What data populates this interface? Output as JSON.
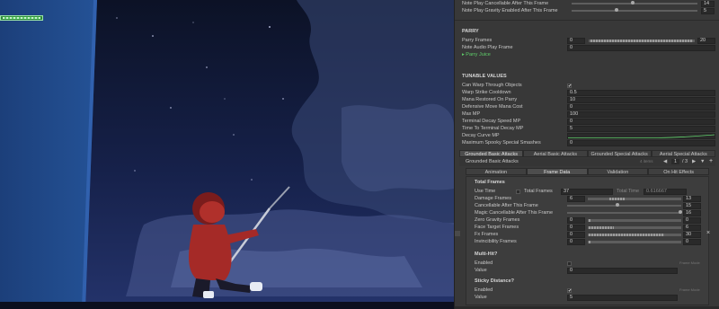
{
  "colors": {
    "accent_green": "#5fcf6a",
    "scene_sky": "#1b2a55",
    "character_red": "#b0302b"
  },
  "top": {
    "rows": [
      {
        "label": "Note Play Cancellable After This Frame",
        "value": "14",
        "slider_fraction": 0.93
      },
      {
        "label": "Note Play Gravity Enabled After This Frame",
        "value": "5",
        "slider_fraction": 0.33
      }
    ]
  },
  "parry": {
    "title": "PARRY",
    "frames_label": "Parry Frames",
    "frames_min": "0",
    "frames_max": "20",
    "audio_label": "Note Audio Play Frame",
    "audio_value": "0",
    "juice_label": "Parry Juice"
  },
  "tunable": {
    "title": "TUNABLE VALUES",
    "rows": [
      {
        "label": "Can Warp Through Objects",
        "value": "✔"
      },
      {
        "label": "Warp Strike Cooldown",
        "value": "0.5"
      },
      {
        "label": "Mana Restored On Parry",
        "value": "10"
      },
      {
        "label": "Defensive Move Mana Cost",
        "value": "0"
      },
      {
        "label": "Max MP",
        "value": "100"
      },
      {
        "label": "Terminal Decay Speed MP",
        "value": "0"
      },
      {
        "label": "Time To Terminal Decay MP",
        "value": "5"
      },
      {
        "label": "Decay Curve MP",
        "value": ""
      },
      {
        "label": "Maximum Spooky Special Smashes",
        "value": "0"
      }
    ]
  },
  "attack_tabs": [
    "Grounded Basic Attacks",
    "Aerial Basic Attacks",
    "Grounded Special Attacks",
    "Aerial Special Attacks"
  ],
  "list": {
    "title": "Grounded Basic Attacks",
    "count_label": "4 items",
    "page": "1",
    "page_total": "/ 3"
  },
  "sub_tabs": [
    "Animation",
    "Frame Data",
    "Validation",
    "On Hit Effects"
  ],
  "total": {
    "title": "Total Frames",
    "use_time_label": "Use Time",
    "total_frames_label": "Total Frames",
    "total_frames_value": "37",
    "total_time_label": "Total Time",
    "total_time_value": "0.616667"
  },
  "frames": [
    {
      "label": "Damage Frames",
      "min": "6",
      "max": "13"
    },
    {
      "label": "Cancellable After This Frame",
      "value": "15"
    },
    {
      "label": "Magic Cancellable After This Frame",
      "value": "16"
    },
    {
      "label": "Zero Gravity Frames",
      "min": "0",
      "max": "0"
    },
    {
      "label": "Face Target Frames",
      "min": "0",
      "max": "6"
    },
    {
      "label": "Fx Frames",
      "min": "0",
      "max": "30"
    },
    {
      "label": "Invincibility Frames",
      "min": "0",
      "max": "0"
    }
  ],
  "multihit": {
    "title": "Multi-Hit?",
    "enabled_label": "Enabled",
    "value_label": "Value",
    "value": "0",
    "hint": "Frame Mode"
  },
  "sticky": {
    "title": "Sticky Distance?",
    "enabled_label": "Enabled",
    "value_label": "Value",
    "value": "5",
    "hint": "Frame Mode",
    "enabled_check": "✔"
  }
}
